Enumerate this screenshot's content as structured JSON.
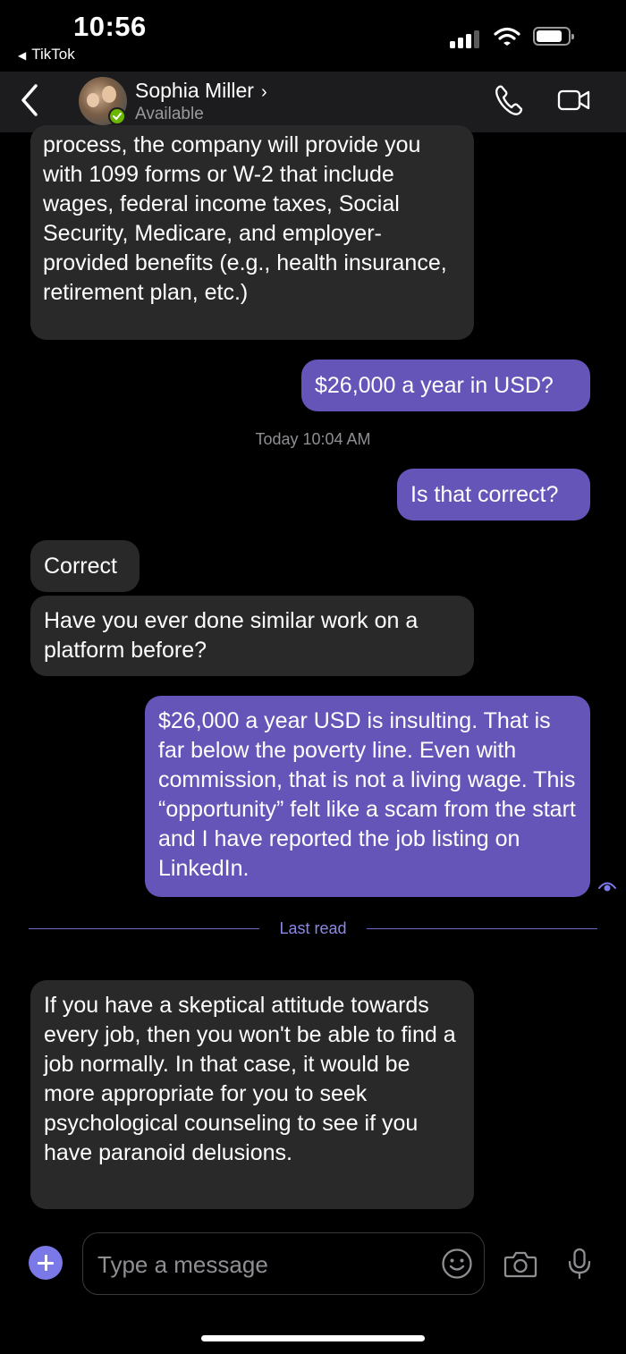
{
  "status_bar": {
    "time": "10:56",
    "back_app": "TikTok",
    "signal_icon": "cellular-signal-icon",
    "wifi_icon": "wifi-icon",
    "battery_icon": "battery-icon"
  },
  "header": {
    "back_icon": "chevron-left-icon",
    "contact_name": "Sophia Miller",
    "name_chevron": "›",
    "status": "Available",
    "presence_color": "#6bb700",
    "call_icon": "phone-icon",
    "video_icon": "video-camera-icon"
  },
  "messages": [
    {
      "direction": "incoming",
      "text": "process, the company will provide you with 1099 forms or W-2 that include wages, federal income taxes, Social Security, Medicare, and employer-provided benefits (e.g., health insurance, retirement plan, etc.)"
    },
    {
      "direction": "outgoing",
      "text": "$26,000 a year in USD?"
    },
    {
      "direction": "outgoing",
      "text": "Is that correct?"
    },
    {
      "direction": "incoming",
      "text": "Correct"
    },
    {
      "direction": "incoming",
      "text": "Have you ever done similar work on a platform before?"
    },
    {
      "direction": "outgoing",
      "text": "$26,000 a year USD is insulting. That is far below the poverty line. Even with commission, that is not a living wage. This “opportunity” felt like a scam from the start and I have reported the job listing on LinkedIn."
    },
    {
      "direction": "incoming",
      "text": "If you have a skeptical attitude towards every job, then you won't be able to find a job normally. In that case, it would be more appropriate for you to seek psychological counseling to see if you have paranoid delusions."
    }
  ],
  "timestamp": "Today 10:04 AM",
  "last_read_label": "Last read",
  "composer": {
    "add_icon": "plus-icon",
    "placeholder": "Type a message",
    "emoji_icon": "emoji-icon",
    "camera_icon": "camera-icon",
    "mic_icon": "microphone-icon"
  },
  "colors": {
    "background": "#000000",
    "incoming_bubble": "#292929",
    "outgoing_bubble": "#6655b8",
    "accent": "#7b79e8"
  }
}
